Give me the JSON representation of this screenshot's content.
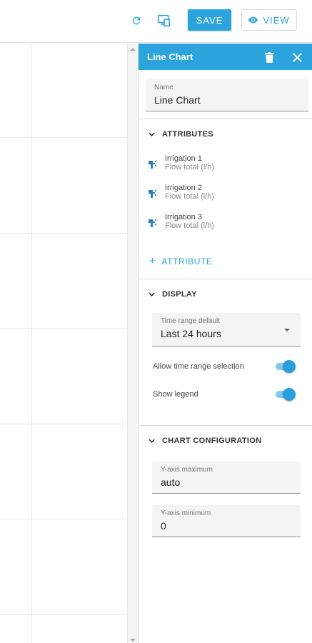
{
  "toolbar": {
    "refresh_icon": "refresh-icon",
    "device_icon": "device-preview-icon",
    "save_label": "SAVE",
    "view_label": "VIEW",
    "accent": "#2ba4dd"
  },
  "panel": {
    "title": "Line Chart",
    "name_field": {
      "label": "Name",
      "value": "Line Chart"
    },
    "attributes_section": {
      "title": "ATTRIBUTES",
      "items": [
        {
          "name": "Irrigation 1",
          "attribute": "Flow total (l/h)"
        },
        {
          "name": "Irrigation 2",
          "attribute": "Flow total (l/h)"
        },
        {
          "name": "Irrigation 3",
          "attribute": "Flow total (l/h)"
        }
      ],
      "add_label": "ATTRIBUTE"
    },
    "display_section": {
      "title": "DISPLAY",
      "time_range": {
        "label": "Time range default",
        "value": "Last 24 hours"
      },
      "allow_time_range_label": "Allow time range selection",
      "allow_time_range_on": true,
      "show_legend_label": "Show legend",
      "show_legend_on": true
    },
    "chart_config_section": {
      "title": "CHART CONFIGURATION",
      "y_max": {
        "label": "Y-axis maximum",
        "value": "auto"
      },
      "y_min": {
        "label": "Y-axis minimum",
        "value": "0"
      }
    }
  }
}
